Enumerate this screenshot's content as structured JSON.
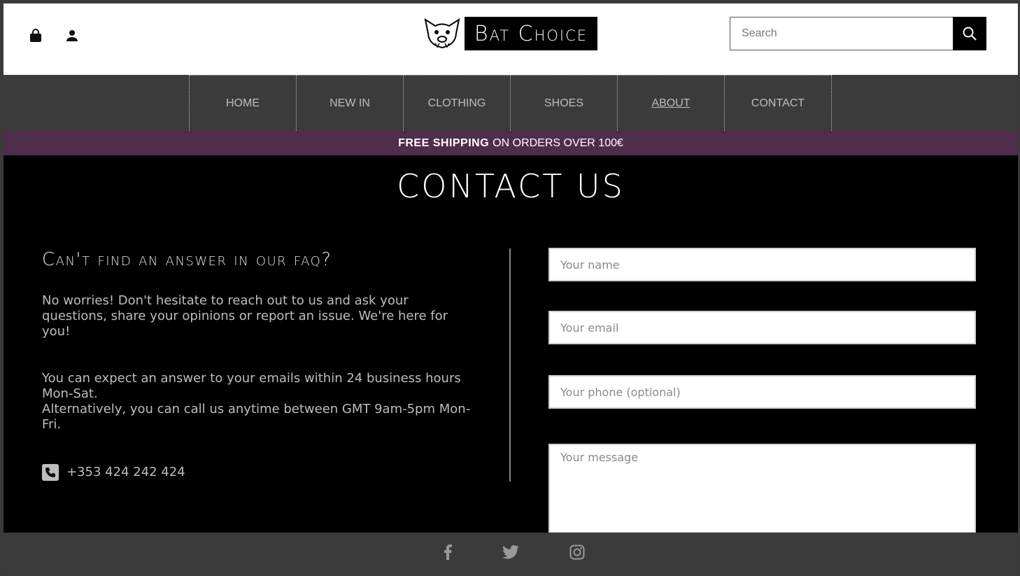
{
  "header": {
    "brand": "Bat Choice",
    "search": {
      "placeholder": "Search",
      "value": ""
    },
    "icons": {
      "bag": "shopping-bag-icon",
      "account": "user-icon",
      "search": "magnifier-icon",
      "logo": "bat-logo-icon"
    }
  },
  "nav": {
    "items": [
      {
        "label": "HOME"
      },
      {
        "label": "NEW IN"
      },
      {
        "label": "CLOTHING"
      },
      {
        "label": "SHOES"
      },
      {
        "label": "ABOUT"
      },
      {
        "label": "CONTACT"
      }
    ]
  },
  "promo": {
    "bold": "FREE SHIPPING",
    "rest": "ON ORDERS OVER 100€"
  },
  "main": {
    "title": "CONTACT US",
    "faq_heading": "Can't find an answer in our faq?",
    "para1": "No worries! Don't hesitate to reach out to us and ask your questions, share your opinions or report an issue. We're here for you!",
    "para2a": "You can expect an answer to your emails within 24 business hours Mon-Sat.",
    "para2b": "Alternatively, you can call us anytime between GMT 9am-5pm Mon-Fri.",
    "phone": "+353 424 242  424"
  },
  "form": {
    "name_placeholder": "Your name",
    "email_placeholder": "Your email",
    "phone_placeholder": "Your phone (optional)",
    "message_placeholder": "Your message"
  },
  "footer": {
    "social": [
      "facebook-icon",
      "twitter-icon",
      "instagram-icon"
    ]
  },
  "colors": {
    "promo_bg": "#4f2d4b",
    "nav_bg": "#3b3b3b",
    "page_bg": "#000000",
    "nav_text": "#bdbdbd"
  }
}
